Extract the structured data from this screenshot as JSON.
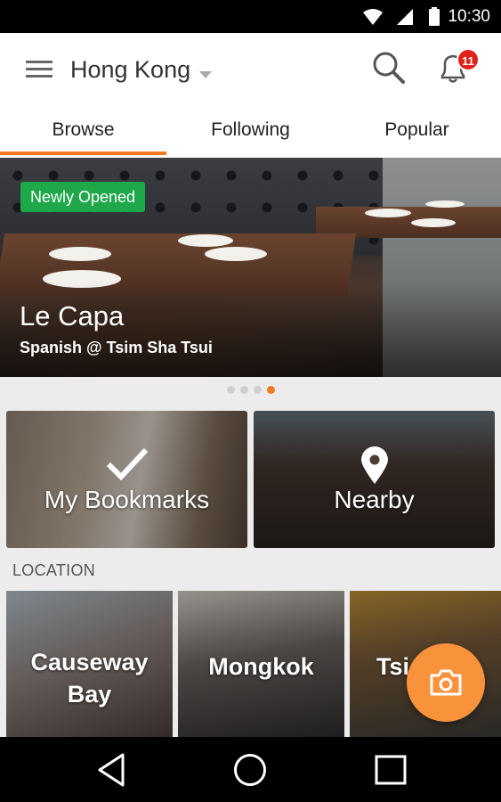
{
  "status_bar": {
    "time": "10:30",
    "icons": [
      "wifi-icon",
      "signal-icon",
      "battery-icon"
    ]
  },
  "app_bar": {
    "city": "Hong Kong",
    "notification_count": "11",
    "icons": [
      "menu-icon",
      "search-icon",
      "bell-icon"
    ]
  },
  "tabs": [
    {
      "label": "Browse",
      "active": true
    },
    {
      "label": "Following",
      "active": false
    },
    {
      "label": "Popular",
      "active": false
    }
  ],
  "hero": {
    "badge": "Newly Opened",
    "title": "Le Capa",
    "subtitle": "Spanish @ Tsim Sha Tsui",
    "page_count": 4,
    "active_page": 4
  },
  "cards": [
    {
      "label": "My Bookmarks",
      "icon": "checkmark-icon"
    },
    {
      "label": "Nearby",
      "icon": "location-pin-icon"
    }
  ],
  "location_section": {
    "title": "LOCATION",
    "items": [
      {
        "label": "Causeway Bay"
      },
      {
        "label": "Mongkok"
      },
      {
        "label": "Tsi"
      }
    ]
  },
  "fab": {
    "icon": "camera-icon"
  },
  "nav_bar": {
    "icons": [
      "back-icon",
      "home-icon",
      "recents-icon"
    ]
  },
  "colors": {
    "accent": "#f47a20",
    "badge_green": "#1ea84a",
    "notification_red": "#e0201b",
    "fab": "#f8923b"
  }
}
